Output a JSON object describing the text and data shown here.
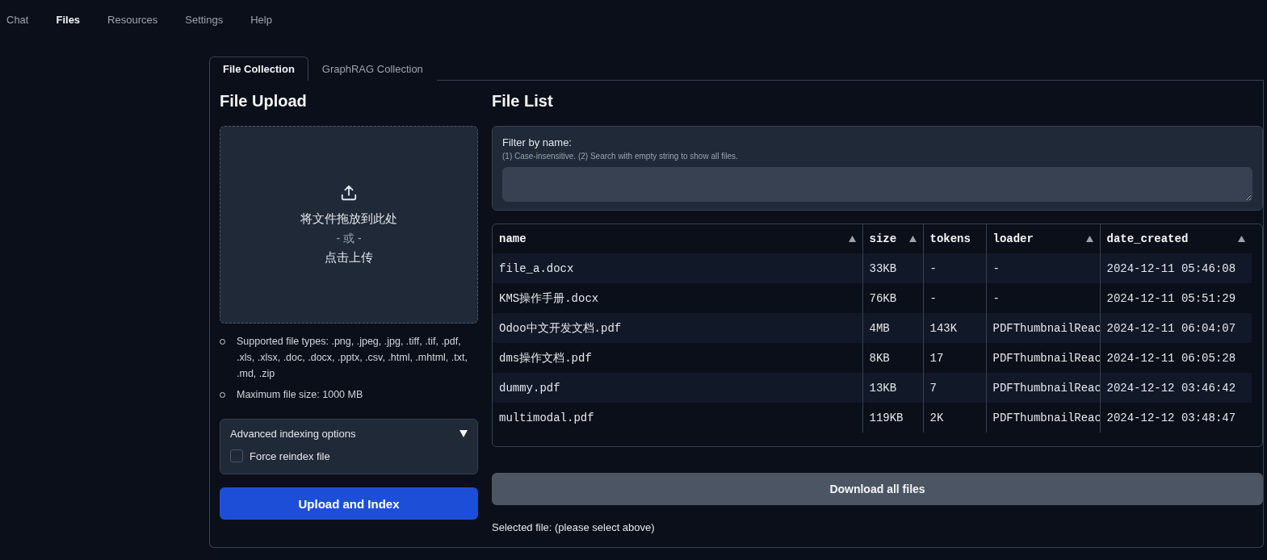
{
  "nav": [
    {
      "label": "Chat",
      "selected": false
    },
    {
      "label": "Files",
      "selected": true
    },
    {
      "label": "Resources",
      "selected": false
    },
    {
      "label": "Settings",
      "selected": false
    },
    {
      "label": "Help",
      "selected": false
    }
  ],
  "tabs": [
    {
      "label": "File Collection",
      "selected": true
    },
    {
      "label": "GraphRAG Collection",
      "selected": false
    }
  ],
  "upload": {
    "title": "File Upload",
    "drop_lines": [
      "将文件拖放到此处",
      "- 或 -",
      "点击上传"
    ],
    "notes": [
      "Supported file types: .png, .jpeg, .jpg, .tiff, .tif, .pdf, .xls, .xlsx, .doc, .docx, .pptx, .csv, .html, .mhtml, .txt, .md, .zip",
      "Maximum file size: 1000 MB"
    ],
    "advanced": {
      "label": "Advanced indexing options",
      "expanded": true,
      "option": {
        "label": "Force reindex file",
        "checked": false
      }
    },
    "button": "Upload and Index"
  },
  "file_list": {
    "title": "File List",
    "filter": {
      "label": "Filter by name:",
      "hint": "(1) Case-insensitive. (2) Search with empty string to show all files."
    },
    "table": {
      "columns": [
        {
          "label": "name",
          "sortable": true
        },
        {
          "label": "size",
          "sortable": true
        },
        {
          "label": "tokens",
          "sortable": false
        },
        {
          "label": "loader",
          "sortable": true
        },
        {
          "label": "date_created",
          "sortable": true
        }
      ],
      "rows": [
        [
          "file_a.docx",
          "33KB",
          "-",
          "-",
          "2024-12-11 05:46:08"
        ],
        [
          "KMS操作手册.docx",
          "76KB",
          "-",
          "-",
          "2024-12-11 05:51:29"
        ],
        [
          "Odoo中文开发文档.pdf",
          "4MB",
          "143K",
          "PDFThumbnailReac",
          "2024-12-11 06:04:07"
        ],
        [
          "dms操作文档.pdf",
          "8KB",
          "17",
          "PDFThumbnailReac",
          "2024-12-11 06:05:28"
        ],
        [
          "dummy.pdf",
          "13KB",
          "7",
          "PDFThumbnailReac",
          "2024-12-12 03:46:42"
        ],
        [
          "multimodal.pdf",
          "119KB",
          "2K",
          "PDFThumbnailReac",
          "2024-12-12 03:48:47"
        ]
      ]
    },
    "download_button": "Download all files",
    "selected_file": "Selected file: (please select above)"
  }
}
